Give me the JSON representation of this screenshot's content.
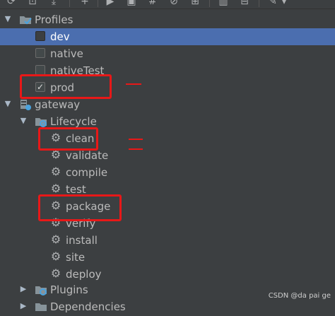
{
  "tree": {
    "profiles": {
      "label": "Profiles",
      "items": [
        {
          "label": "dev",
          "checked": false,
          "selected": true
        },
        {
          "label": "native",
          "checked": false,
          "selected": false
        },
        {
          "label": "nativeTest",
          "checked": false,
          "selected": false
        },
        {
          "label": "prod",
          "checked": true,
          "selected": false
        }
      ]
    },
    "gateway": {
      "label": "gateway",
      "lifecycle": {
        "label": "Lifecycle",
        "phases": [
          "clean",
          "validate",
          "compile",
          "test",
          "package",
          "verify",
          "install",
          "site",
          "deploy"
        ]
      },
      "plugins_label": "Plugins",
      "dependencies_label": "Dependencies"
    }
  },
  "check_glyph": "✓",
  "watermark": "CSDN @da pai ge",
  "colors": {
    "background": "#3c3f41",
    "selection": "#4b6eaf",
    "annotation_red": "#e81818",
    "text": "#bbbbbb"
  }
}
